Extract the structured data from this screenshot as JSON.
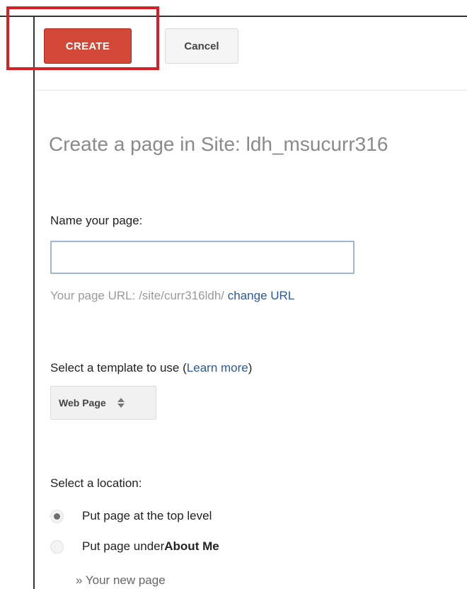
{
  "toolbar": {
    "create_label": "CREATE",
    "cancel_label": "Cancel"
  },
  "title": "Create a page in Site: ldh_msucurr316",
  "name_section": {
    "label": "Name your page:",
    "input_value": "",
    "url_prefix": "Your page URL: /site/curr316ldh/",
    "change_url_label": "change URL"
  },
  "template_section": {
    "label": "Select a template to use",
    "learn_more_open": "(",
    "learn_more_label": "Learn more",
    "learn_more_close": ")",
    "selected_template": "Web Page",
    "selector_icon": "up-down-arrows-icon"
  },
  "location_section": {
    "label": "Select a location:",
    "options": [
      {
        "label": "Put page at the top level",
        "bold": "",
        "checked": true
      },
      {
        "label": "Put page under ",
        "bold": "About Me",
        "checked": false
      }
    ],
    "new_page_hint": "» Your new page"
  },
  "colors": {
    "create_button": "#d14836",
    "highlight_box": "#d81f26",
    "link": "#2b58a6",
    "title": "#8a8a8a"
  }
}
